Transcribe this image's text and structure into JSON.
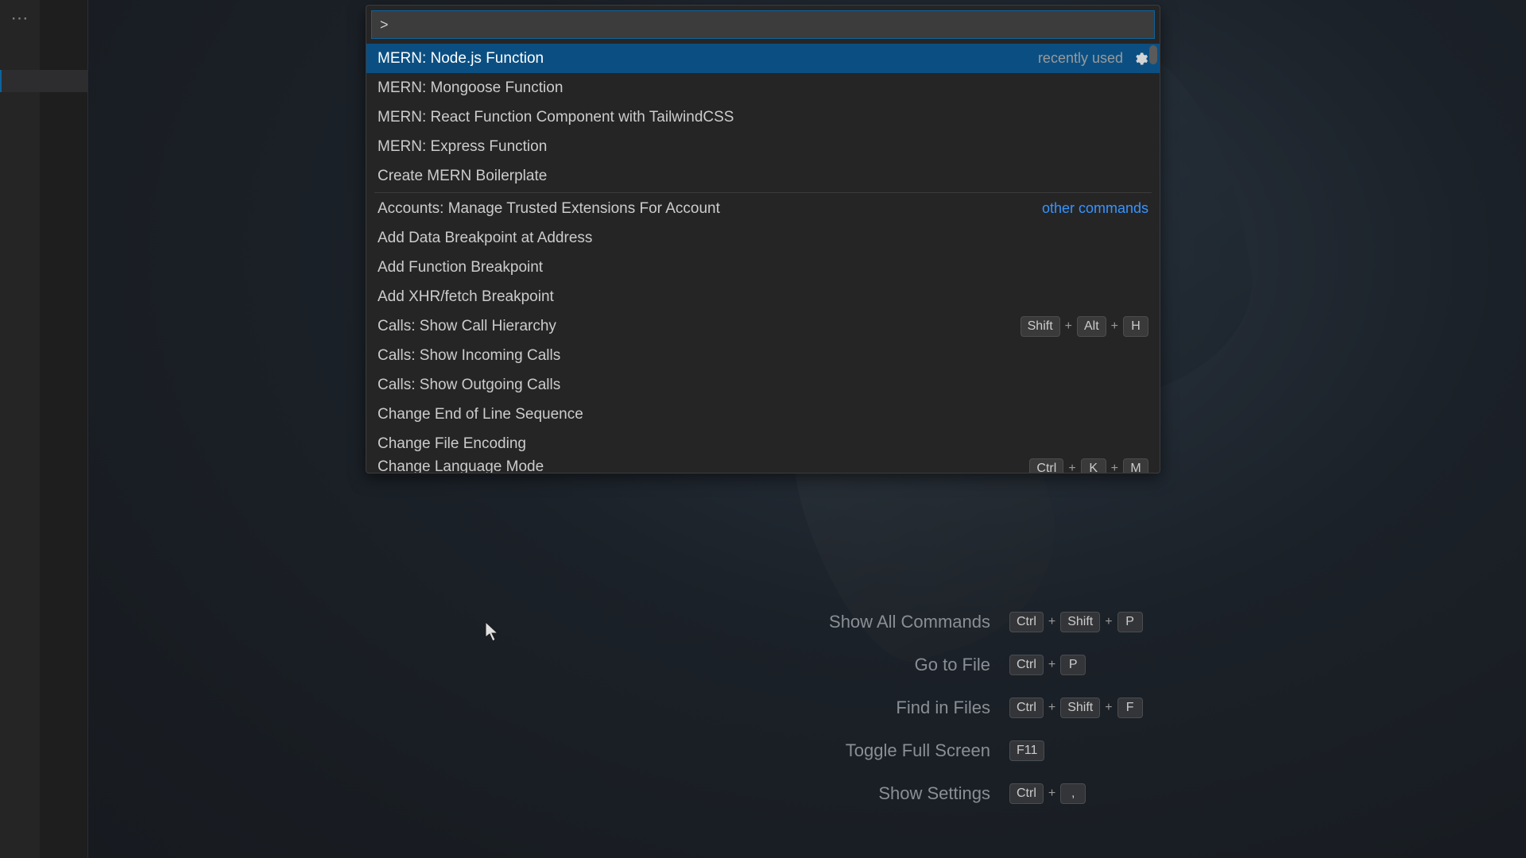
{
  "palette": {
    "input_value": ">",
    "rows": [
      {
        "label": "MERN: Node.js Function",
        "badge": "recently used",
        "selected": true,
        "gear": true
      },
      {
        "label": "MERN: Mongoose Function"
      },
      {
        "label": "MERN: React Function Component with TailwindCSS"
      },
      {
        "label": "MERN: Express Function"
      },
      {
        "label": "Create MERN Boilerplate"
      }
    ],
    "divider_after": 5,
    "other_rows": [
      {
        "label": "Accounts: Manage Trusted Extensions For Account",
        "right_label": "other commands",
        "right_class": "link-blue"
      },
      {
        "label": "Add Data Breakpoint at Address"
      },
      {
        "label": "Add Function Breakpoint"
      },
      {
        "label": "Add XHR/fetch Breakpoint"
      },
      {
        "label": "Calls: Show Call Hierarchy",
        "keys": [
          "Shift",
          "Alt",
          "H"
        ]
      },
      {
        "label": "Calls: Show Incoming Calls"
      },
      {
        "label": "Calls: Show Outgoing Calls"
      },
      {
        "label": "Change End of Line Sequence"
      },
      {
        "label": "Change File Encoding"
      }
    ],
    "cutoff": {
      "label": "Change Language Mode",
      "keys": [
        "Ctrl",
        "K",
        "M"
      ]
    }
  },
  "hints": [
    {
      "label": "Show All Commands",
      "keys": [
        "Ctrl",
        "Shift",
        "P"
      ]
    },
    {
      "label": "Go to File",
      "keys": [
        "Ctrl",
        "P"
      ]
    },
    {
      "label": "Find in Files",
      "keys": [
        "Ctrl",
        "Shift",
        "F"
      ]
    },
    {
      "label": "Toggle Full Screen",
      "keys": [
        "F11"
      ]
    },
    {
      "label": "Show Settings",
      "keys": [
        "Ctrl",
        ","
      ]
    }
  ]
}
